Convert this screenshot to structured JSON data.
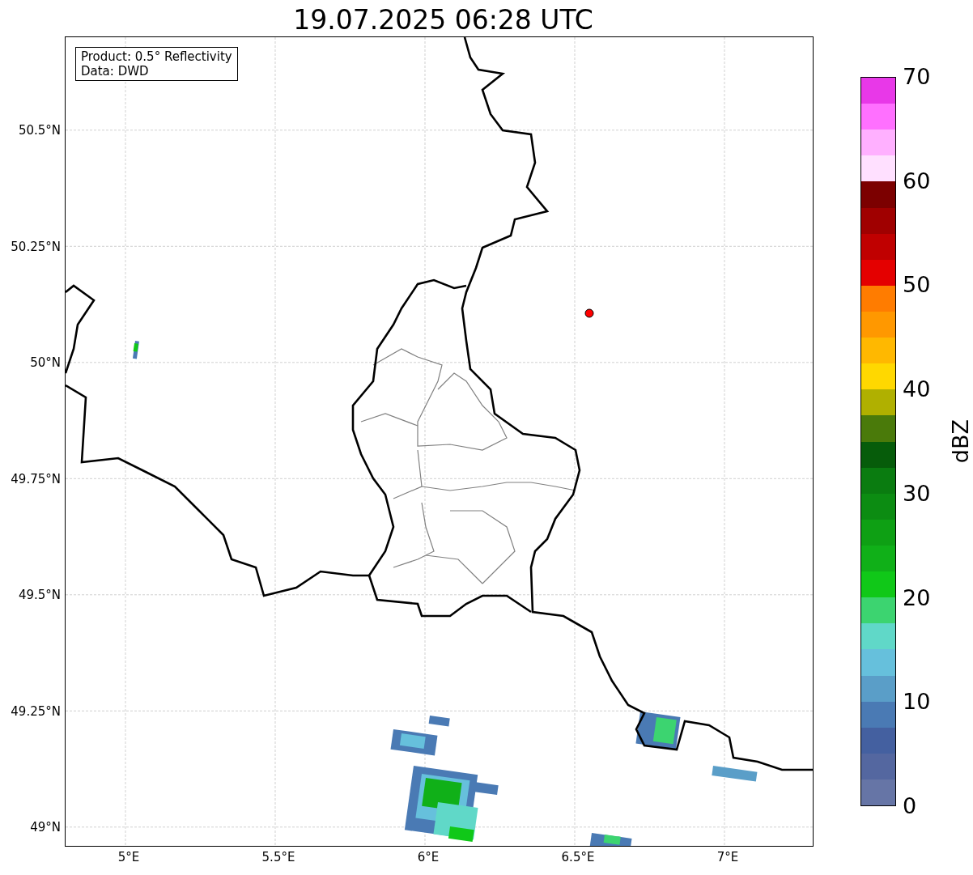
{
  "title": "19.07.2025 06:28 UTC",
  "info_box": [
    "Product: 0.5° Reflectivity",
    "Data: DWD"
  ],
  "lat_ticks": [
    "50.5°N",
    "50.25°N",
    "50°N",
    "49.75°N",
    "49.5°N",
    "49.25°N",
    "49°N"
  ],
  "lon_ticks": [
    "5°E",
    "5.5°E",
    "6°E",
    "6.5°E",
    "7°E"
  ],
  "colorbar": {
    "label": "dBZ",
    "ticks": [
      "70",
      "60",
      "50",
      "40",
      "30",
      "20",
      "10",
      "0"
    ],
    "bins": [
      {
        "color": "#e838e8"
      },
      {
        "color": "#ff70ff"
      },
      {
        "color": "#ffb0ff"
      },
      {
        "color": "#ffe0ff"
      },
      {
        "color": "#7c0000"
      },
      {
        "color": "#a00000"
      },
      {
        "color": "#c00000"
      },
      {
        "color": "#e40000"
      },
      {
        "color": "#ff7c00"
      },
      {
        "color": "#ff9800"
      },
      {
        "color": "#ffb800"
      },
      {
        "color": "#ffd800"
      },
      {
        "color": "#b0b000"
      },
      {
        "color": "#4a7a0a"
      },
      {
        "color": "#065c0a"
      },
      {
        "color": "#0a7c10"
      },
      {
        "color": "#0c8c12"
      },
      {
        "color": "#0ea014"
      },
      {
        "color": "#10b018"
      },
      {
        "color": "#10c818"
      },
      {
        "color": "#3cd470"
      },
      {
        "color": "#60d8c8"
      },
      {
        "color": "#66c0dc"
      },
      {
        "color": "#5a9ec8"
      },
      {
        "color": "#4a7ab4"
      },
      {
        "color": "#4460a0"
      },
      {
        "color": "#5467a0"
      },
      {
        "color": "#6675a6"
      }
    ]
  }
}
